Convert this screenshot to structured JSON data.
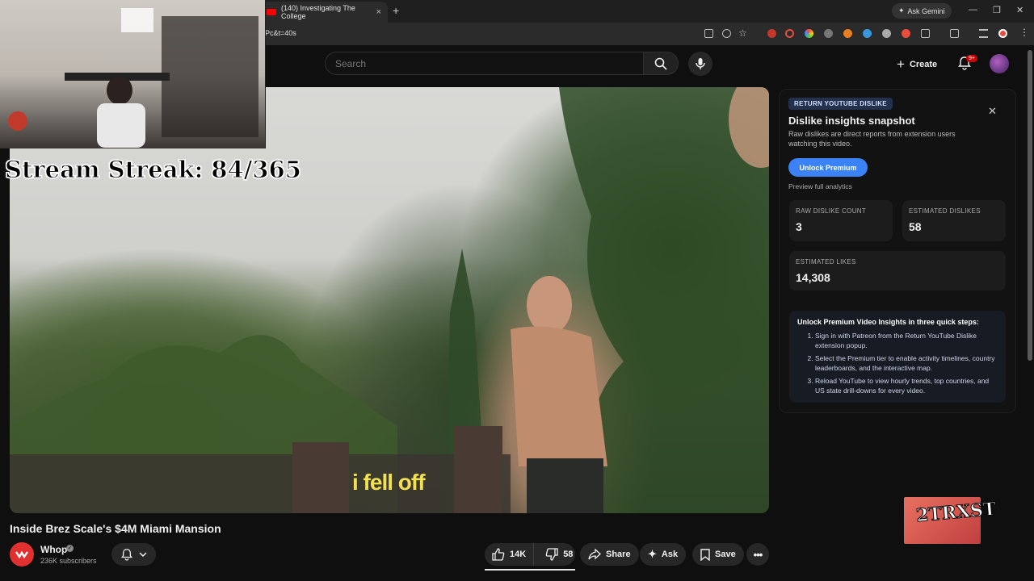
{
  "browser": {
    "tab_title": "(140) Investigating The College",
    "url_fragment": "Pc&t=40s",
    "ask_gemini": "Ask Gemini",
    "new_tab": "+",
    "tab_close": "×",
    "window_min": "—",
    "window_restore": "❐",
    "window_close": "✕"
  },
  "header": {
    "search_placeholder": "Search",
    "create_label": "Create",
    "notifications_badge": "9+"
  },
  "overlay": {
    "stream_streak": "Stream Streak: 84/365",
    "brand_logo": "2TRXST"
  },
  "video": {
    "subtitle": "i fell off",
    "title": "Inside Brez Scale's $4M Miami Mansion"
  },
  "channel": {
    "name": "Whop",
    "subscribers": "236K subscribers"
  },
  "actions": {
    "likes": "14K",
    "dislikes": "58",
    "share": "Share",
    "ask": "Ask",
    "save": "Save"
  },
  "panel": {
    "badge": "RETURN YOUTUBE DISLIKE",
    "title": "Dislike insights snapshot",
    "description": "Raw dislikes are direct reports from extension users watching this video.",
    "unlock_button": "Unlock Premium",
    "preview_link": "Preview full analytics",
    "stats": {
      "raw_label": "RAW DISLIKE COUNT",
      "raw_value": "3",
      "est_dislikes_label": "ESTIMATED DISLIKES",
      "est_dislikes_value": "58",
      "est_likes_label": "ESTIMATED LIKES",
      "est_likes_value": "14,308"
    },
    "steps_title": "Unlock Premium Video Insights in three quick steps:",
    "steps": [
      "Sign in with Patreon from the Return YouTube Dislike extension popup.",
      "Select the Premium tier to enable activity timelines, country leaderboards, and the interactive map.",
      "Reload YouTube to view hourly trends, top countries, and US state drill-downs for every video."
    ]
  },
  "colors": {
    "accent_blue": "#3b82f6",
    "youtube_red": "#ff0000",
    "subtitle_yellow": "#f3df52"
  }
}
